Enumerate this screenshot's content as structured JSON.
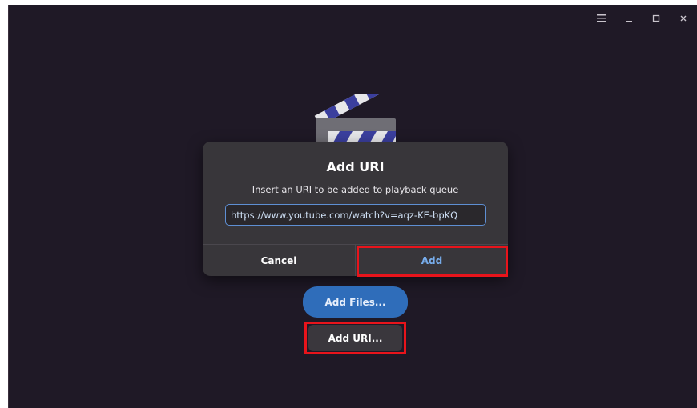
{
  "window": {
    "controls": {
      "menu_icon": "hamburger-menu-icon",
      "minimize_icon": "minimize-icon",
      "maximize_icon": "maximize-icon",
      "close_icon": "close-icon"
    }
  },
  "illustration": {
    "icon": "clapperboard-icon",
    "colors": {
      "stripe_dark": "#3b3f9e",
      "stripe_light": "#e7e7ea",
      "body": "#6f6e75"
    }
  },
  "dialog": {
    "title": "Add URI",
    "subtitle": "Insert an URI to be added to playback queue",
    "uri_input": {
      "value": "https://www.youtube.com/watch?v=aqz-KE-bpKQ",
      "placeholder": ""
    },
    "cancel_label": "Cancel",
    "add_label": "Add"
  },
  "main": {
    "add_files_label": "Add Files...",
    "add_uri_label": "Add URI..."
  },
  "colors": {
    "background": "#1f1926",
    "dialog": "#38363a",
    "accent": "#3584e4",
    "accent_text": "#78aeed",
    "highlight": "#e8141b"
  }
}
